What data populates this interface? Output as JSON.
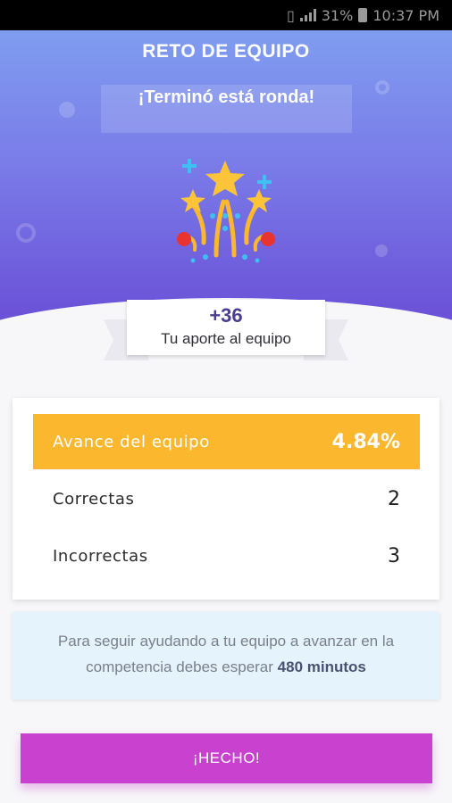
{
  "status_bar": {
    "battery": "31%",
    "time": "10:37 PM"
  },
  "header": {
    "title": "RETO DE EQUIPO",
    "subtitle": "¡Terminó está ronda!"
  },
  "contribution": {
    "points": "+36",
    "label": "Tu aporte al equipo"
  },
  "stats": {
    "progress_label": "Avance del equipo",
    "progress_value": "4.84%",
    "correct_label": "Correctas",
    "correct_value": "2",
    "incorrect_label": "Incorrectas",
    "incorrect_value": "3"
  },
  "info": {
    "text": "Para seguir ayudando a tu equipo a avanzar en la competencia debes esperar",
    "highlight": "480 minutos"
  },
  "actions": {
    "done_label": "¡HECHO!"
  },
  "colors": {
    "accent": "#fbb72e",
    "button": "#c841cf",
    "header_top": "#7f9df0",
    "header_bottom": "#6a4fd7"
  }
}
